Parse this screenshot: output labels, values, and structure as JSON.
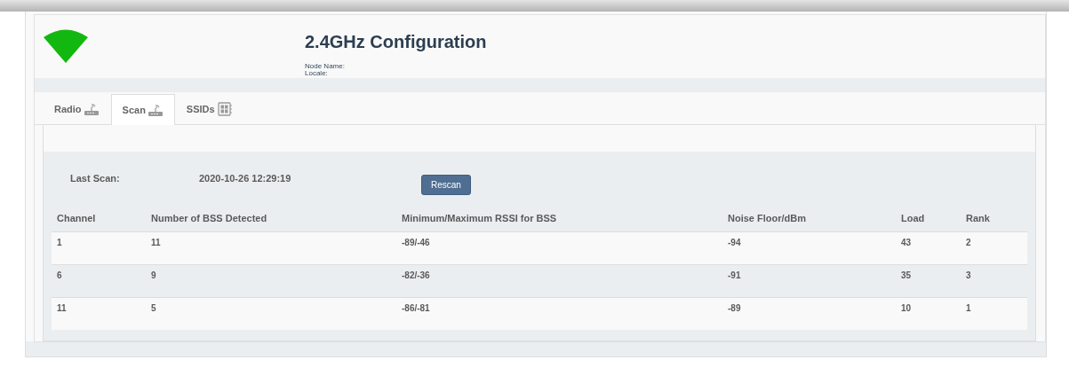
{
  "header": {
    "title": "2.4GHz Configuration",
    "fields": [
      {
        "label": "Node Name:"
      },
      {
        "label": "Locale:"
      }
    ]
  },
  "tabs": [
    {
      "label": "Radio",
      "kind": "router",
      "selected": false
    },
    {
      "label": "Scan",
      "kind": "router",
      "selected": true
    },
    {
      "label": "SSIDs",
      "kind": "chip",
      "selected": false
    }
  ],
  "scan": {
    "label": "Last Scan:",
    "value": "2020-10-26 12:29:19",
    "button": "Rescan"
  },
  "table": {
    "columns": [
      "Channel",
      "Number of BSS Detected",
      "Minimum/Maximum RSSI for BSS",
      "Noise Floor/dBm",
      "Load",
      "Rank"
    ],
    "rows": [
      [
        "1",
        "11",
        "-89/-46",
        "-94",
        "43",
        "2"
      ],
      [
        "6",
        "9",
        "-82/-36",
        "-91",
        "35",
        "3"
      ],
      [
        "11",
        "5",
        "-86/-81",
        "-89",
        "10",
        "1"
      ]
    ]
  }
}
